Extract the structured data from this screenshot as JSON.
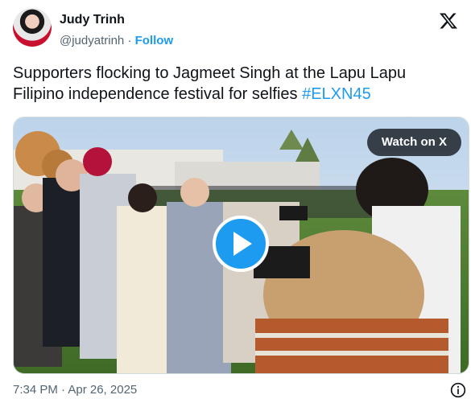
{
  "author": {
    "name": "Judy Trinh",
    "handle": "@judyatrinh",
    "separator": "·",
    "follow_label": "Follow"
  },
  "tweet": {
    "text": "Supporters flocking to Jagmeet Singh at the Lapu Lapu Filipino independence festival for selfies ",
    "hashtag": "#ELXN45"
  },
  "media": {
    "watch_label": "Watch on X",
    "play_icon": "play-icon"
  },
  "footer": {
    "timestamp": "7:34 PM · Apr 26, 2025",
    "info_icon": "info-icon"
  },
  "colors": {
    "accent": "#1d9bf0",
    "text": "#0f1419",
    "muted": "#536471"
  }
}
